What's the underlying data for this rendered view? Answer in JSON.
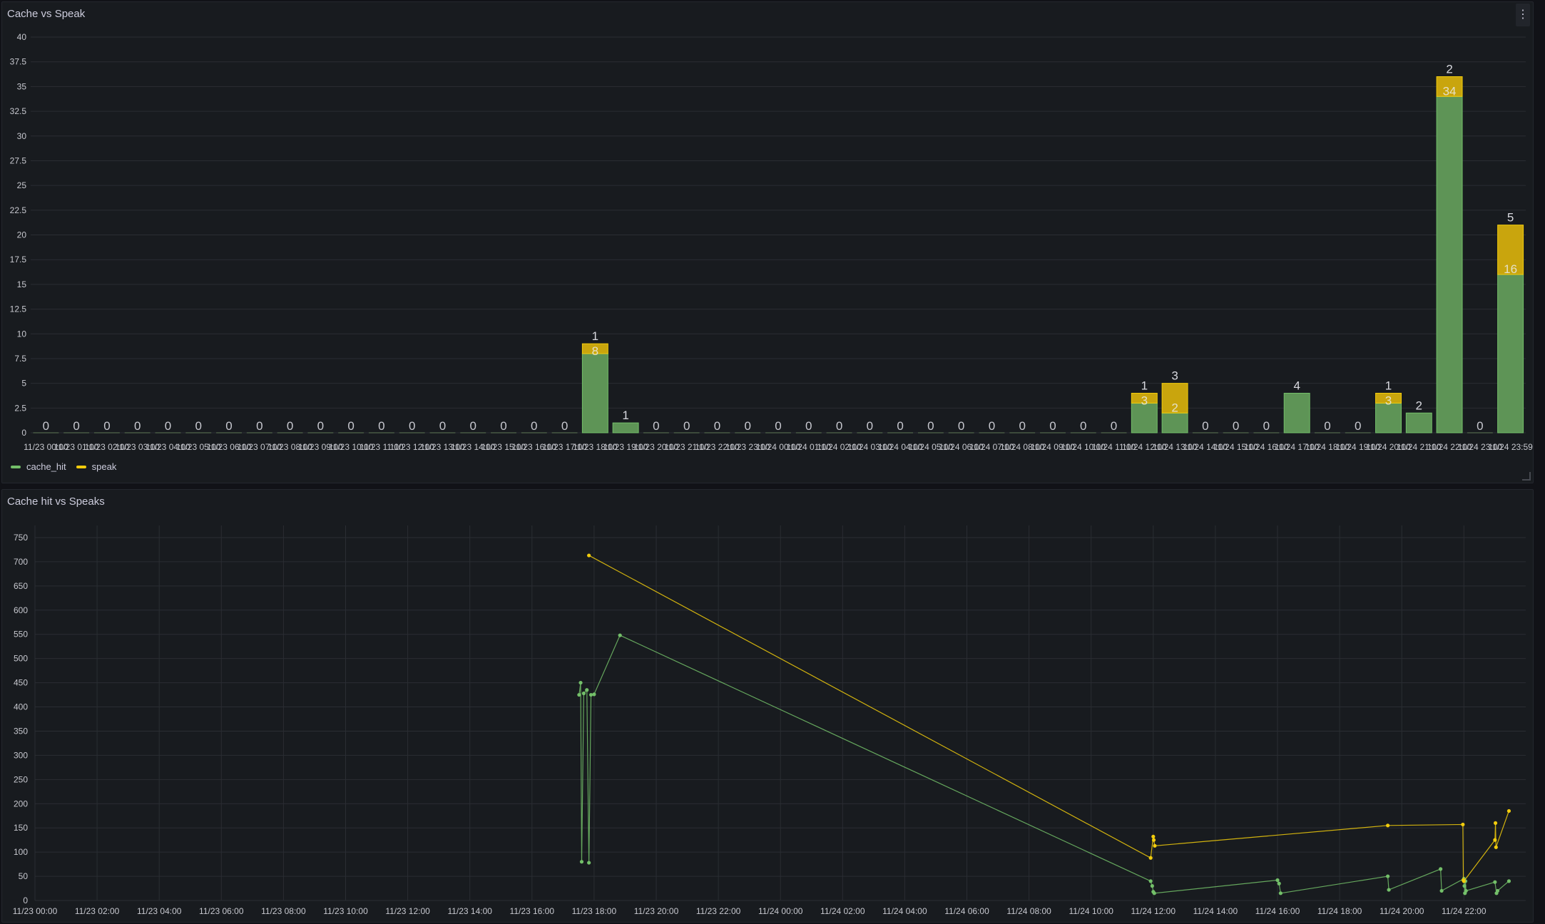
{
  "panels": {
    "top": {
      "title": "Cache vs Speak",
      "menu_icon": "kebab-menu-icon"
    },
    "bottom": {
      "title": "Cache hit vs Speaks"
    }
  },
  "legend": [
    {
      "name": "cache_hit",
      "color": "#73bf69"
    },
    {
      "name": "speak",
      "color": "#f2cc0c"
    }
  ],
  "chart_data": [
    {
      "type": "bar",
      "stacked": true,
      "title": "Cache vs Speak",
      "categories": [
        "11/23 00:00",
        "11/23 01:00",
        "11/23 02:00",
        "11/23 03:00",
        "11/23 04:00",
        "11/23 05:00",
        "11/23 06:00",
        "11/23 07:00",
        "11/23 08:00",
        "11/23 09:00",
        "11/23 10:00",
        "11/23 11:00",
        "11/23 12:00",
        "11/23 13:00",
        "11/23 14:00",
        "11/23 15:00",
        "11/23 16:00",
        "11/23 17:00",
        "11/23 18:00",
        "11/23 19:00",
        "11/23 20:00",
        "11/23 21:00",
        "11/23 22:00",
        "11/23 23:00",
        "11/24 00:00",
        "11/24 01:00",
        "11/24 02:00",
        "11/24 03:00",
        "11/24 04:00",
        "11/24 05:00",
        "11/24 06:00",
        "11/24 07:00",
        "11/24 08:00",
        "11/24 09:00",
        "11/24 10:00",
        "11/24 11:00",
        "11/24 12:00",
        "11/24 13:00",
        "11/24 14:00",
        "11/24 15:00",
        "11/24 16:00",
        "11/24 17:00",
        "11/24 18:00",
        "11/24 19:00",
        "11/24 20:00",
        "11/24 21:00",
        "11/24 22:00",
        "11/24 23:00",
        "11/24 23:59"
      ],
      "series": [
        {
          "name": "cache_hit",
          "color": "#73bf69",
          "values": [
            0,
            0,
            0,
            0,
            0,
            0,
            0,
            0,
            0,
            0,
            0,
            0,
            0,
            0,
            0,
            0,
            0,
            0,
            8,
            1,
            0,
            0,
            0,
            0,
            0,
            0,
            0,
            0,
            0,
            0,
            0,
            0,
            0,
            0,
            0,
            0,
            3,
            2,
            0,
            0,
            0,
            4,
            0,
            0,
            3,
            2,
            34,
            0,
            16
          ]
        },
        {
          "name": "speak",
          "color": "#f2cc0c",
          "values": [
            0,
            0,
            0,
            0,
            0,
            0,
            0,
            0,
            0,
            0,
            0,
            0,
            0,
            0,
            0,
            0,
            0,
            0,
            1,
            0,
            0,
            0,
            0,
            0,
            0,
            0,
            0,
            0,
            0,
            0,
            0,
            0,
            0,
            0,
            0,
            0,
            1,
            3,
            0,
            0,
            0,
            0,
            0,
            0,
            1,
            0,
            2,
            0,
            5
          ]
        }
      ],
      "ylim": [
        0,
        40
      ],
      "yticks": [
        "0",
        "2.5",
        "5",
        "7.5",
        "10",
        "12.5",
        "15",
        "17.5",
        "20",
        "22.5",
        "25",
        "27.5",
        "30",
        "32.5",
        "35",
        "37.5",
        "40"
      ],
      "grid": true,
      "legend": "bottom-left"
    },
    {
      "type": "line",
      "title": "Cache hit vs Speaks",
      "ylim": [
        0,
        775
      ],
      "yticks": [
        "0",
        "50",
        "100",
        "150",
        "200",
        "250",
        "300",
        "350",
        "400",
        "450",
        "500",
        "550",
        "600",
        "650",
        "700",
        "750"
      ],
      "xticks": [
        "11/23 00:00",
        "11/23 02:00",
        "11/23 04:00",
        "11/23 06:00",
        "11/23 08:00",
        "11/23 10:00",
        "11/23 12:00",
        "11/23 14:00",
        "11/23 16:00",
        "11/23 18:00",
        "11/23 20:00",
        "11/23 22:00",
        "11/24 00:00",
        "11/24 02:00",
        "11/24 04:00",
        "11/24 06:00",
        "11/24 08:00",
        "11/24 10:00",
        "11/24 12:00",
        "11/24 14:00",
        "11/24 16:00",
        "11/24 18:00",
        "11/24 20:00",
        "11/24 22:00"
      ],
      "grid": true,
      "series": [
        {
          "name": "cache_hit",
          "color": "#73bf69",
          "points": [
            [
              "11/23 17:31",
              425
            ],
            [
              "11/23 17:34",
              450
            ],
            [
              "11/23 17:36",
              80
            ],
            [
              "11/23 17:40",
              428
            ],
            [
              "11/23 17:46",
              435
            ],
            [
              "11/23 17:50",
              78
            ],
            [
              "11/23 17:54",
              425
            ],
            [
              "11/23 18:00",
              426
            ],
            [
              "11/23 18:50",
              548
            ],
            [
              "11/24 11:55",
              40
            ],
            [
              "11/24 11:58",
              30
            ],
            [
              "11/24 12:00",
              18
            ],
            [
              "11/24 12:02",
              15
            ],
            [
              "11/24 16:00",
              42
            ],
            [
              "11/24 16:03",
              35
            ],
            [
              "11/24 16:06",
              15
            ],
            [
              "11/24 19:33",
              50
            ],
            [
              "11/24 19:35",
              22
            ],
            [
              "11/24 21:15",
              65
            ],
            [
              "11/24 21:17",
              20
            ],
            [
              "11/24 22:00",
              45
            ],
            [
              "11/24 22:01",
              30
            ],
            [
              "11/24 22:02",
              15
            ],
            [
              "11/24 22:03",
              40
            ],
            [
              "11/24 22:04",
              20
            ],
            [
              "11/24 23:00",
              38
            ],
            [
              "11/24 23:03",
              15
            ],
            [
              "11/24 23:05",
              20
            ],
            [
              "11/24 23:27",
              40
            ]
          ]
        },
        {
          "name": "speak",
          "color": "#f2cc0c",
          "points": [
            [
              "11/23 17:50",
              713
            ],
            [
              "11/24 11:55",
              88
            ],
            [
              "11/24 12:00",
              132
            ],
            [
              "11/24 12:01",
              125
            ],
            [
              "11/24 12:03",
              113
            ],
            [
              "11/24 19:33",
              155
            ],
            [
              "11/24 21:58",
              157
            ],
            [
              "11/24 21:59",
              42
            ],
            [
              "11/24 22:00",
              40
            ],
            [
              "11/24 23:00",
              125
            ],
            [
              "11/24 23:01",
              160
            ],
            [
              "11/24 23:02",
              110
            ],
            [
              "11/24 23:27",
              185
            ]
          ]
        }
      ]
    }
  ]
}
